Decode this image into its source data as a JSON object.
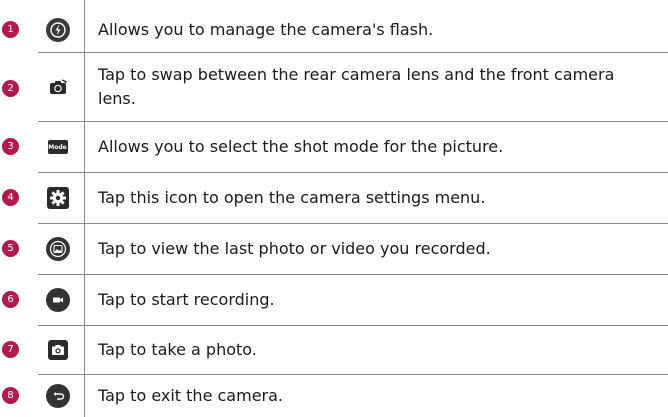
{
  "rows": [
    {
      "number": "1",
      "icon": "flash-icon",
      "text": "Allows you to manage the camera's flash."
    },
    {
      "number": "2",
      "icon": "swap-camera-icon",
      "text": "Tap to swap between the rear camera lens and the front camera lens."
    },
    {
      "number": "3",
      "icon": "mode-icon",
      "icon_text": "Mode",
      "text": "Allows you to select the shot mode for the picture."
    },
    {
      "number": "4",
      "icon": "settings-gear-icon",
      "text": "Tap this icon to open the camera settings menu."
    },
    {
      "number": "5",
      "icon": "gallery-icon",
      "text": "Tap to view the last photo or video you recorded."
    },
    {
      "number": "6",
      "icon": "record-video-icon",
      "text": "Tap to start recording."
    },
    {
      "number": "7",
      "icon": "capture-photo-icon",
      "text": "Tap to take a photo."
    },
    {
      "number": "8",
      "icon": "back-exit-icon",
      "text": "Tap to exit the camera."
    }
  ],
  "colors": {
    "badge": "#b5174f",
    "icon_dark": "#333333",
    "rule": "#8a8a8a"
  }
}
